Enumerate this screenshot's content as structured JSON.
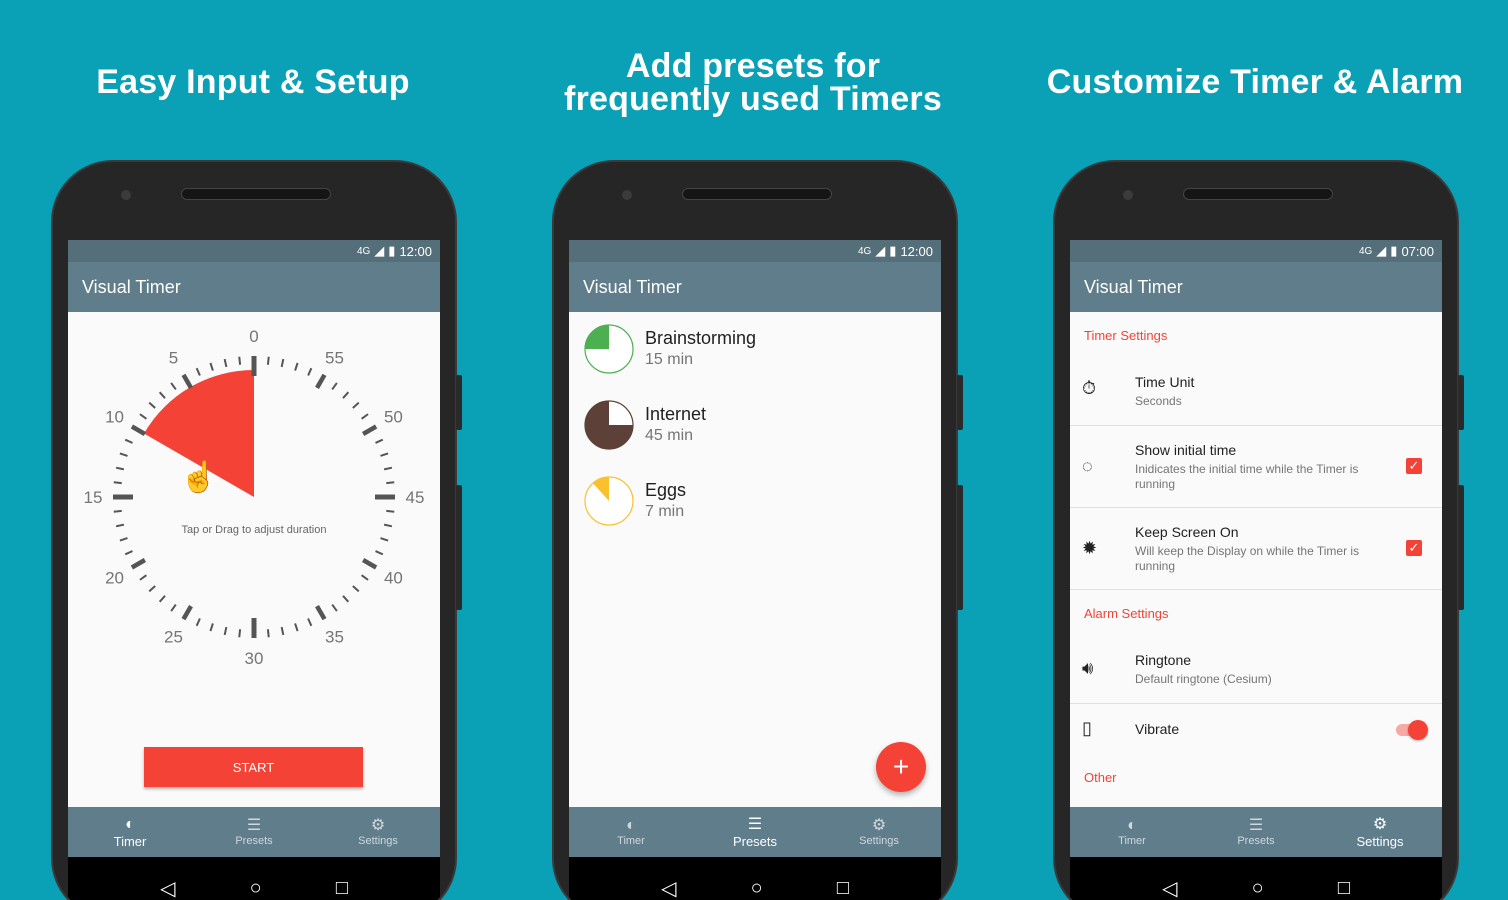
{
  "colors": {
    "background": "#0aa0b6",
    "appbar": "#607d8b",
    "statusbar": "#546e7a",
    "accent": "#f44336"
  },
  "panels": [
    {
      "headline": "Easy Input & Setup"
    },
    {
      "headline_line1": "Add presets for",
      "headline_line2": "frequently used Timers"
    },
    {
      "headline": "Customize Timer & Alarm"
    }
  ],
  "timer_screen": {
    "status_time": "12:00",
    "status_network": "4G",
    "app_title": "Visual Timer",
    "dial_labels": [
      "0",
      "5",
      "10",
      "15",
      "20",
      "25",
      "30",
      "35",
      "40",
      "45",
      "50",
      "55"
    ],
    "selected_minutes": 10,
    "hint": "Tap or Drag to adjust duration",
    "start_label": "START"
  },
  "presets_screen": {
    "status_time": "12:00",
    "status_network": "4G",
    "app_title": "Visual Timer",
    "presets": [
      {
        "name": "Brainstorming",
        "duration": "15 min",
        "minutes": 15,
        "color": "#4caf50"
      },
      {
        "name": "Internet",
        "duration": "45 min",
        "minutes": 45,
        "color": "#5d4037"
      },
      {
        "name": "Eggs",
        "duration": "7 min",
        "minutes": 7,
        "color": "#fbc02d"
      }
    ],
    "fab_icon": "+"
  },
  "settings_screen": {
    "status_time": "07:00",
    "status_network": "4G",
    "app_title": "Visual Timer",
    "timer_settings_header": "Timer Settings",
    "time_unit_title": "Time Unit",
    "time_unit_value": "Seconds",
    "initial_time_title": "Show initial time",
    "initial_time_desc": "Inidicates the initial time while the Timer is running",
    "initial_time_checked": true,
    "keep_screen_title": "Keep Screen On",
    "keep_screen_desc": "Will keep the Display on while the Timer is running",
    "keep_screen_checked": true,
    "alarm_settings_header": "Alarm Settings",
    "ringtone_title": "Ringtone",
    "ringtone_value": "Default ringtone (Cesium)",
    "vibrate_title": "Vibrate",
    "vibrate_on": true,
    "other_header": "Other"
  },
  "nav": {
    "timer": "Timer",
    "presets": "Presets",
    "settings": "Settings"
  },
  "icons": {
    "timer": "timer-icon",
    "presets": "list-icon",
    "settings": "gear-icon",
    "back": "back-icon",
    "home": "home-icon",
    "recents": "recents-icon"
  }
}
